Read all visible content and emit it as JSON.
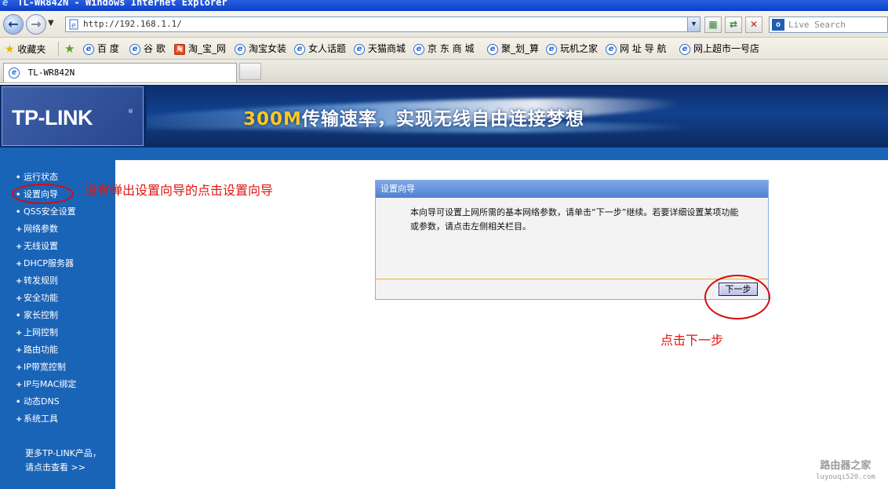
{
  "window": {
    "title": "TL-WR842N - Windows Internet Explorer"
  },
  "address_bar": {
    "url": "http://192.168.1.1/",
    "search_placeholder": "Live Search"
  },
  "favorites": {
    "label": "收藏夹",
    "items": [
      "百 度",
      "谷 歌",
      "淘_宝_网",
      "淘宝女装",
      "女人话题",
      "天猫商城",
      "京 东 商 城",
      "聚_划_算",
      "玩机之家",
      "网 址 导 航",
      "网上超市一号店"
    ]
  },
  "tab": {
    "title": "TL-WR842N"
  },
  "banner": {
    "logo": "TP-LINK",
    "logo_reg": "®",
    "slogan_highlight": "300M",
    "slogan_rest": "传输速率，实现无线自由连接梦想"
  },
  "sidebar": {
    "items": [
      {
        "label": "运行状态",
        "bullet": "•"
      },
      {
        "label": "设置向导",
        "bullet": "•"
      },
      {
        "label": "QSS安全设置",
        "bullet": "•"
      },
      {
        "label": "网络参数",
        "bullet": "+"
      },
      {
        "label": "无线设置",
        "bullet": "+"
      },
      {
        "label": "DHCP服务器",
        "bullet": "+"
      },
      {
        "label": "转发规则",
        "bullet": "+"
      },
      {
        "label": "安全功能",
        "bullet": "+"
      },
      {
        "label": "家长控制",
        "bullet": "•"
      },
      {
        "label": "上网控制",
        "bullet": "+"
      },
      {
        "label": "路由功能",
        "bullet": "+"
      },
      {
        "label": "IP带宽控制",
        "bullet": "+"
      },
      {
        "label": "IP与MAC绑定",
        "bullet": "+"
      },
      {
        "label": "动态DNS",
        "bullet": "•"
      },
      {
        "label": "系统工具",
        "bullet": "+"
      }
    ],
    "more_line1": "更多TP-LINK产品，",
    "more_line2": "请点击查看 >>"
  },
  "wizard": {
    "title": "设置向导",
    "text": "本向导可设置上网所需的基本网络参数，请单击“下一步”继续。若要详细设置某项功能或参数，请点击左侧相关栏目。",
    "next_label": "下一步"
  },
  "annotations": {
    "sidebar_note": "没有弹出设置向导的点击设置向导",
    "next_note": "点击下一步"
  },
  "watermark": {
    "name": "路由器之家",
    "url": "luyouqi520.com"
  }
}
